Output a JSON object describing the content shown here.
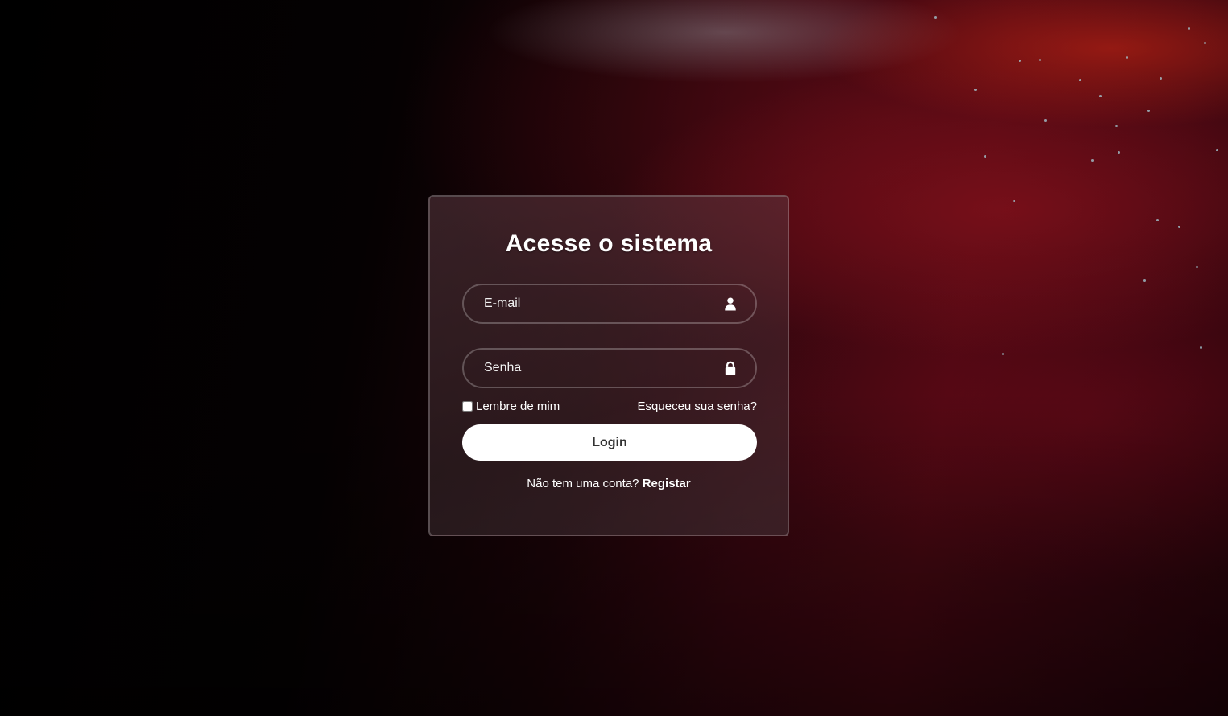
{
  "login": {
    "title": "Acesse o sistema",
    "email_placeholder": "E-mail",
    "email_value": "",
    "password_placeholder": "Senha",
    "password_value": "",
    "remember_label": "Lembre de mim",
    "remember_checked": false,
    "forgot_label": "Esqueceu sua senha?",
    "submit_label": "Login",
    "register_prompt": "Não tem uma conta?",
    "register_link": "Registar"
  },
  "icons": {
    "email": "user-icon",
    "password": "lock-icon"
  },
  "colors": {
    "accent_red": "#4a0812",
    "button_bg": "#ffffff",
    "button_text": "#333333"
  }
}
